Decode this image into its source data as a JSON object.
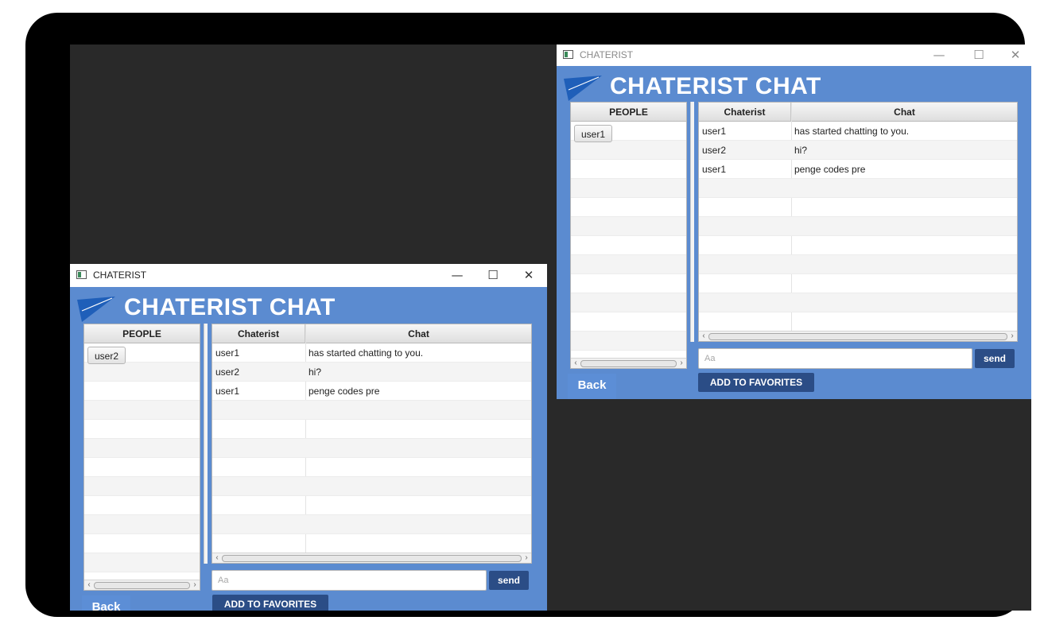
{
  "windows": [
    {
      "title": "CHATERIST",
      "controls": {
        "minimize": "—",
        "maximize": "☐",
        "close": "✕"
      },
      "heading": "CHATERIST CHAT",
      "people_header": "PEOPLE",
      "people": [
        "user1"
      ],
      "chat_headers": {
        "user": "Chaterist",
        "message": "Chat"
      },
      "messages": [
        {
          "user": "user1",
          "text": "has started chatting to you."
        },
        {
          "user": "user2",
          "text": "hi?"
        },
        {
          "user": "user1",
          "text": "penge codes pre"
        }
      ],
      "input_placeholder": "Aa",
      "send_label": "send",
      "favorites_label": "ADD TO FAVORITES",
      "back_label": "Back"
    },
    {
      "title": "CHATERIST",
      "controls": {
        "minimize": "—",
        "maximize": "☐",
        "close": "✕"
      },
      "heading": "CHATERIST CHAT",
      "people_header": "PEOPLE",
      "people": [
        "user2"
      ],
      "chat_headers": {
        "user": "Chaterist",
        "message": "Chat"
      },
      "messages": [
        {
          "user": "user1",
          "text": "has started chatting to you."
        },
        {
          "user": "user2",
          "text": "hi?"
        },
        {
          "user": "user1",
          "text": "penge codes pre"
        }
      ],
      "input_placeholder": "Aa",
      "send_label": "send",
      "favorites_label": "ADD TO FAVORITES",
      "back_label": "Back"
    }
  ],
  "colors": {
    "window_background": "#5b8bd0",
    "button_dark_blue": "#2b4d86",
    "back_button_blue": "#5c8ed6",
    "desktop": "#292929"
  }
}
